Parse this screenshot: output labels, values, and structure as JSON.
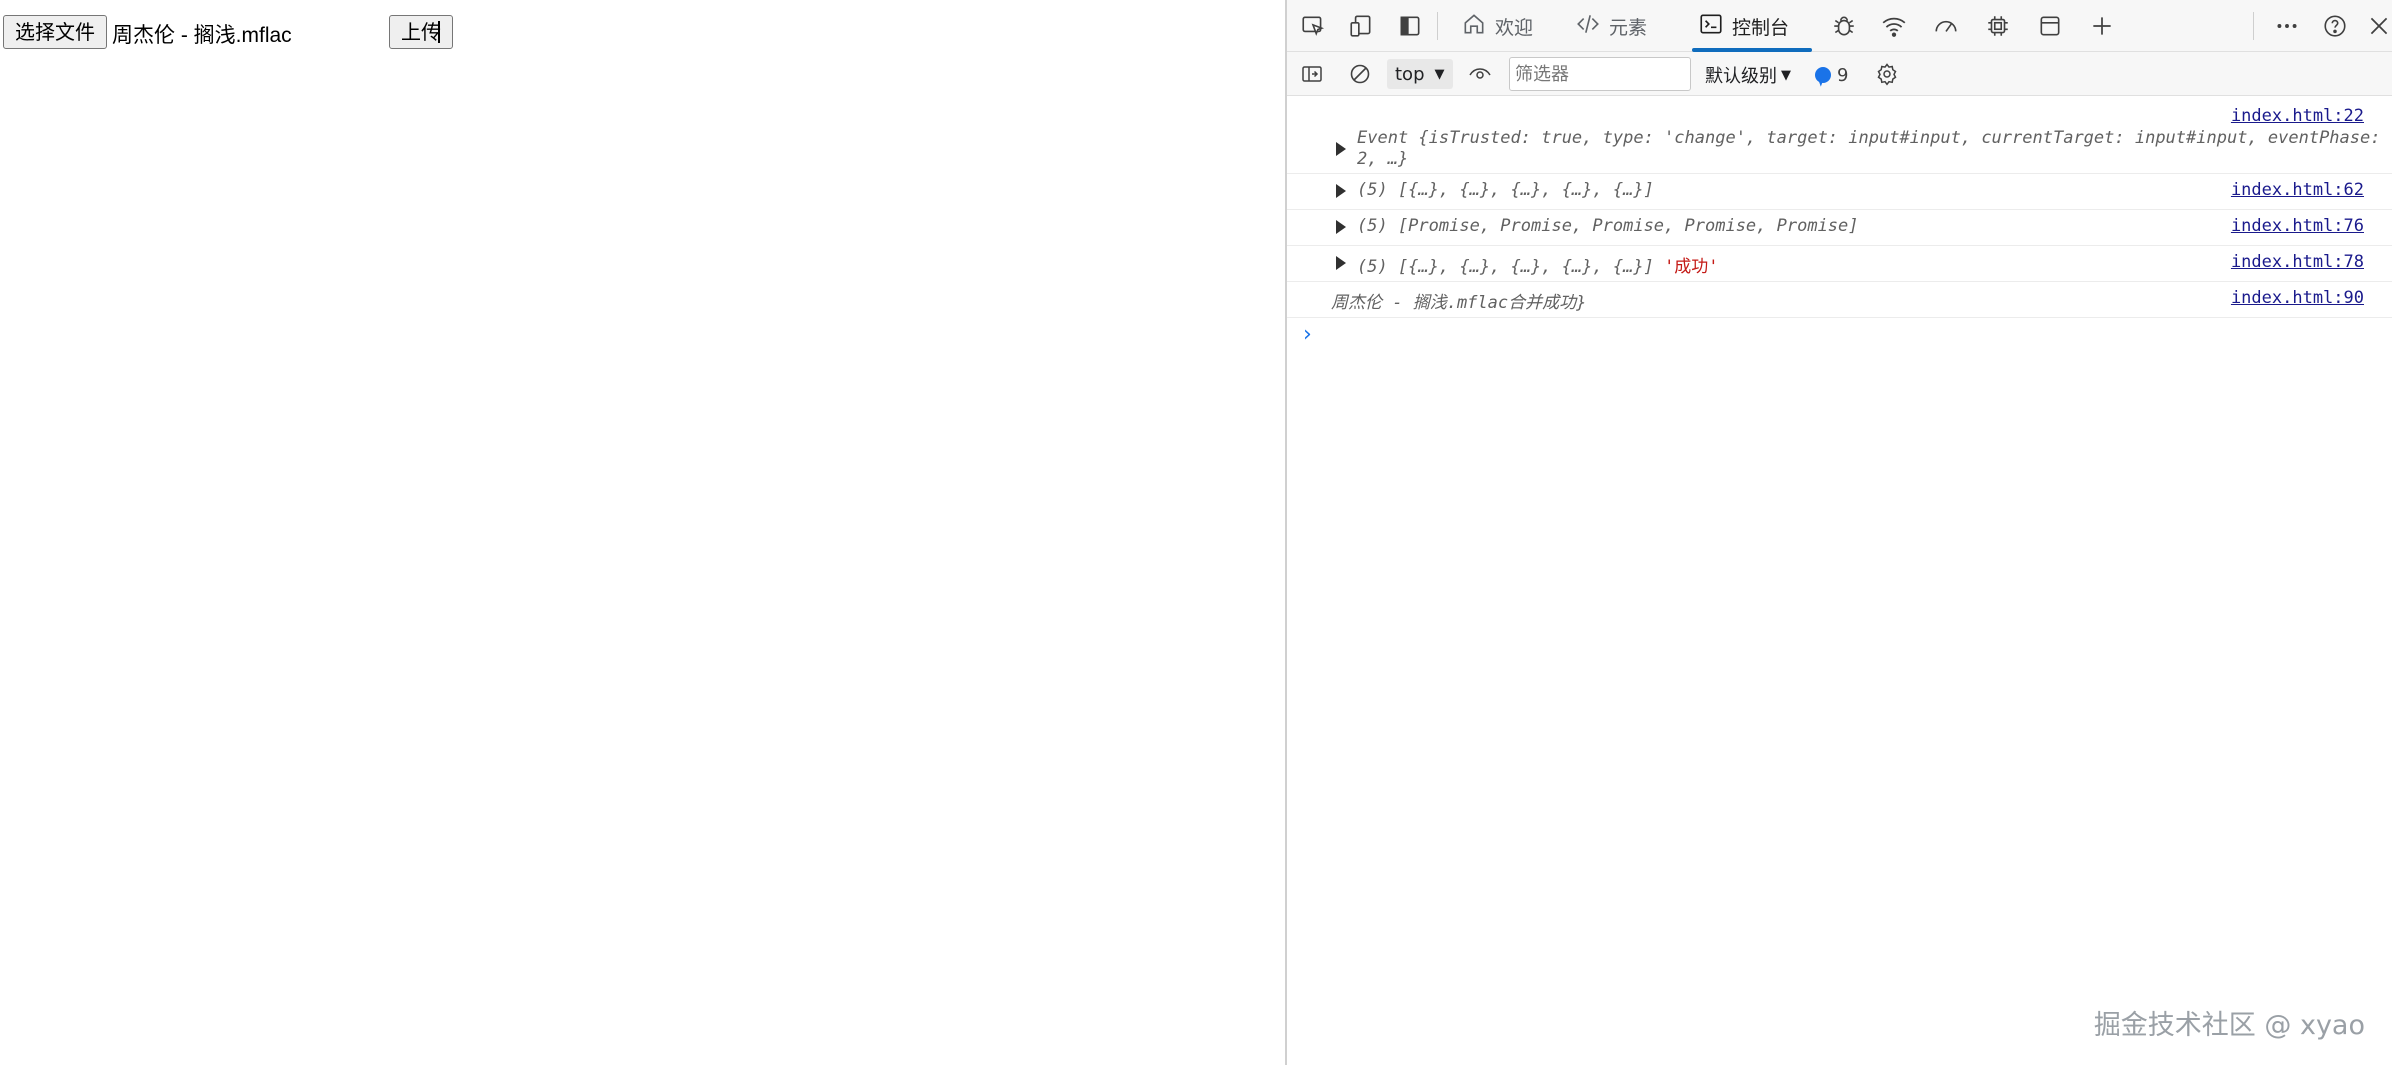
{
  "page": {
    "choose_file_label": "选择文件",
    "file_name": "周杰伦 - 搁浅.mflac",
    "upload_label": "上传"
  },
  "devtools": {
    "tabs": [
      {
        "label": "欢迎",
        "icon": "home-icon"
      },
      {
        "label": "元素",
        "icon": "code-icon"
      },
      {
        "label": "控制台",
        "icon": "console-icon",
        "active": true
      }
    ],
    "toolbar_icons": [
      "inspect-icon",
      "device-emulation-icon",
      "dock-side-icon",
      "bug-icon",
      "wifi-icon",
      "performance-icon",
      "cpu-icon",
      "application-icon",
      "add-tab-icon",
      "more-icon",
      "help-icon",
      "close-icon"
    ],
    "console_bar": {
      "context": "top",
      "filter_placeholder": "筛选器",
      "level": "默认级别",
      "issues_count": "9"
    },
    "messages": [
      {
        "source": "index.html:22",
        "line1": "Event {isTrusted: true, type: 'change', target: input#input, currentTarget: input#input, eventPhase:",
        "line2": "2, …}"
      },
      {
        "source": "index.html:62",
        "text": "(5) [{…}, {…}, {…}, {…}, {…}]"
      },
      {
        "source": "index.html:76",
        "text": "(5) [Promise, Promise, Promise, Promise, Promise]"
      },
      {
        "source": "index.html:78",
        "text": "(5) [{…}, {…}, {…}, {…}, {…}]",
        "suffix": "'成功'"
      },
      {
        "source": "index.html:90",
        "text": "周杰伦 - 搁浅.mflac合并成功}"
      }
    ],
    "accent_color": "#0f6cbd"
  },
  "watermark": "掘金技术社区 @ xyao"
}
